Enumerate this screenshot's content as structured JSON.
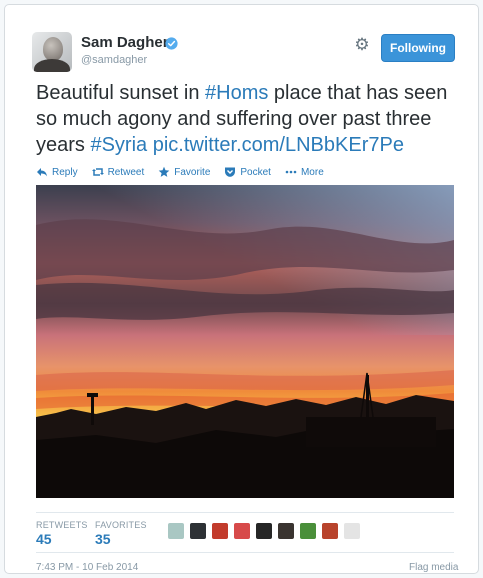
{
  "author": {
    "name": "Sam Dagher",
    "handle": "@samdagher",
    "verified_icon": "verified-badge-icon"
  },
  "header": {
    "settings_icon": "gear-icon",
    "follow_label": "Following"
  },
  "tweet": {
    "text_1": "Beautiful sunset in ",
    "hashtag_1": "#Homs",
    "text_2": " place that has seen so much agony and suffering over past three years ",
    "hashtag_2": "#Syria",
    "text_3": " ",
    "link": "pic.twitter.com/LNBbKEr7Pe"
  },
  "actions": {
    "reply": "Reply",
    "retweet": "Retweet",
    "favorite": "Favorite",
    "pocket": "Pocket",
    "more": "More"
  },
  "stats": {
    "retweets_label": "RETWEETS",
    "retweets_value": "45",
    "favorites_label": "FAVORITES",
    "favorites_value": "35"
  },
  "favoriters": [
    {
      "name": "favoriter-avatar-1",
      "color": "#a9c7c3"
    },
    {
      "name": "favoriter-avatar-2",
      "color": "#2d3135"
    },
    {
      "name": "favoriter-avatar-3",
      "color": "#c23b2c"
    },
    {
      "name": "favoriter-avatar-4",
      "color": "#d74a4a"
    },
    {
      "name": "favoriter-avatar-5",
      "color": "#262626"
    },
    {
      "name": "favoriter-avatar-6",
      "color": "#3a3430"
    },
    {
      "name": "favoriter-avatar-7",
      "color": "#4a8f3a"
    },
    {
      "name": "favoriter-avatar-8",
      "color": "#b8432c"
    },
    {
      "name": "favoriter-avatar-9",
      "color": "#e4e4e4"
    }
  ],
  "footer": {
    "timestamp": "7:43 PM - 10 Feb 2014",
    "flag_label": "Flag media"
  },
  "colors": {
    "link": "#2b7bb9",
    "follow_button": "#3b94d9",
    "muted": "#8899a6"
  }
}
